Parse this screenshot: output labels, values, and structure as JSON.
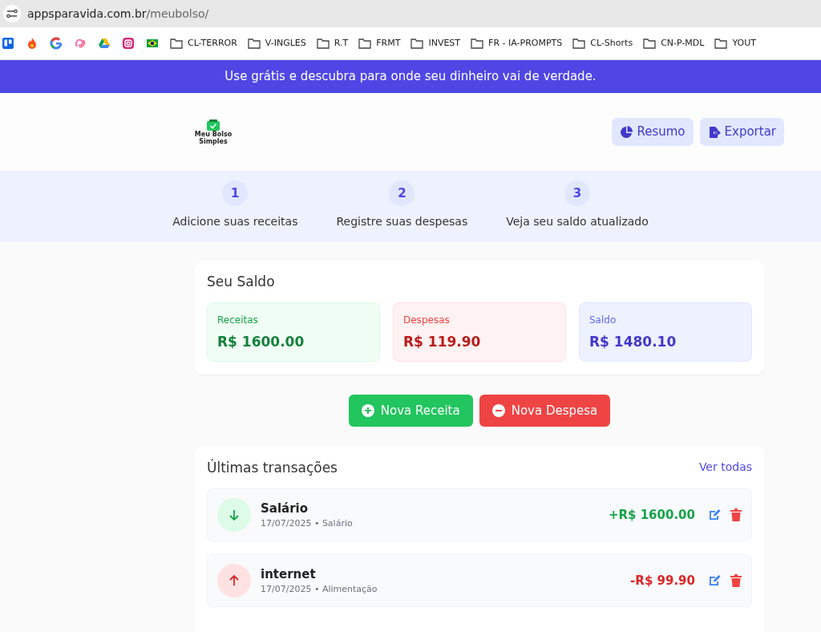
{
  "browser": {
    "url_host": "appsparavida.com.br",
    "url_path": "/meubolso/",
    "bookmarks": [
      {
        "kind": "favicon"
      },
      {
        "kind": "favicon"
      },
      {
        "kind": "favicon"
      },
      {
        "kind": "favicon"
      },
      {
        "kind": "favicon"
      },
      {
        "kind": "favicon"
      },
      {
        "kind": "favicon"
      },
      {
        "kind": "folder",
        "label": "CL-TERROR"
      },
      {
        "kind": "folder",
        "label": "V-INGLES"
      },
      {
        "kind": "folder",
        "label": "R.T"
      },
      {
        "kind": "folder",
        "label": "FRMT"
      },
      {
        "kind": "folder",
        "label": "INVEST"
      },
      {
        "kind": "folder",
        "label": "FR - IA-PROMPTS"
      },
      {
        "kind": "folder",
        "label": "CL-Shorts"
      },
      {
        "kind": "folder",
        "label": "CN-P-MDL"
      },
      {
        "kind": "folder",
        "label": "YOUT"
      }
    ]
  },
  "banner": "Use grátis e descubra para onde seu dinheiro vai de verdade.",
  "header": {
    "logo_line_1": "Meu Bolso",
    "logo_line_2": "Simples",
    "buttons": [
      {
        "kind": "chart",
        "label": "Resumo"
      },
      {
        "kind": "export",
        "label": "Exportar"
      }
    ]
  },
  "steps": [
    {
      "number": "1",
      "label": "Adicione suas receitas"
    },
    {
      "number": "2",
      "label": "Registre suas despesas"
    },
    {
      "number": "3",
      "label": "Veja seu saldo atualizado"
    }
  ],
  "balance": {
    "title": "Seu Saldo",
    "cards": [
      {
        "kind": "income",
        "label": "Receitas",
        "value": "R$ 1600.00"
      },
      {
        "kind": "expense",
        "label": "Despesas",
        "value": "R$ 119.90"
      },
      {
        "kind": "balance",
        "label": "Saldo",
        "value": "R$ 1480.10"
      }
    ]
  },
  "actions": [
    {
      "kind": "income",
      "label": "Nova Receita"
    },
    {
      "kind": "expense",
      "label": "Nova Despesa"
    }
  ],
  "transactions": {
    "title": "Últimas transações",
    "link": "Ver todas",
    "rows": [
      {
        "kind": "income",
        "name": "Salário",
        "meta": "17/07/2025 • Salário",
        "amount": "+R$ 1600.00"
      },
      {
        "kind": "expense",
        "name": "internet",
        "meta": "17/07/2025 • Alimentação",
        "amount": "-R$ 99.90"
      }
    ]
  }
}
